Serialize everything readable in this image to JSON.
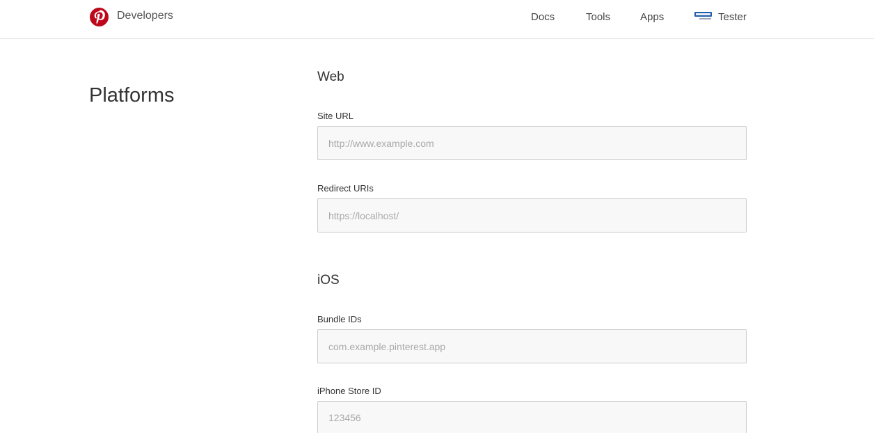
{
  "header": {
    "brand_label": "Developers",
    "logo_icon": "pinterest-logo-icon",
    "brand_color": "#bd081c",
    "nav": {
      "docs": "Docs",
      "tools": "Tools",
      "apps": "Apps"
    },
    "user": {
      "avatar_icon": "login-avatar-icon",
      "name": "Tester"
    }
  },
  "main": {
    "page_title": "Platforms",
    "web": {
      "heading": "Web",
      "site_url": {
        "label": "Site URL",
        "placeholder": "http://www.example.com",
        "value": ""
      },
      "redirect_uris": {
        "label": "Redirect URIs",
        "placeholder": "https://localhost/",
        "value": ""
      }
    },
    "ios": {
      "heading": "iOS",
      "bundle_ids": {
        "label": "Bundle IDs",
        "placeholder": "com.example.pinterest.app",
        "value": ""
      },
      "iphone_store_id": {
        "label": "iPhone Store ID",
        "placeholder": "123456",
        "value": ""
      }
    }
  }
}
